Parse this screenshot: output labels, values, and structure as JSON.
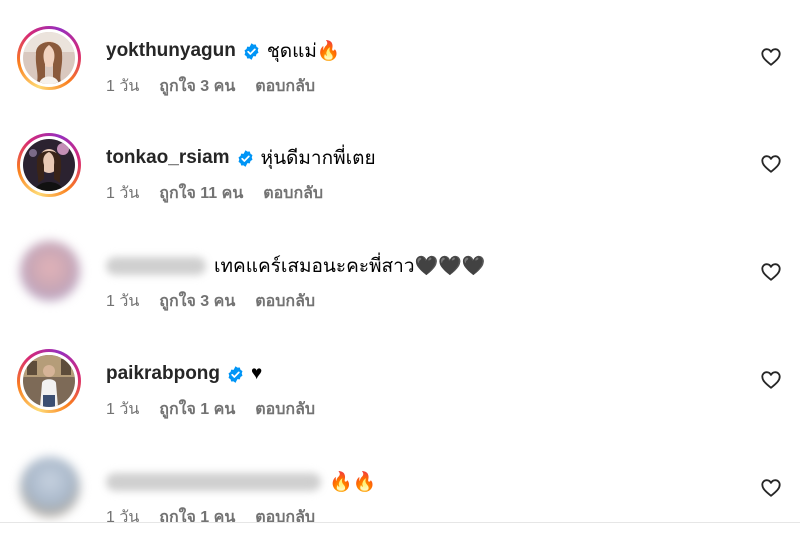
{
  "comments": [
    {
      "username": "yokthunyagun",
      "verified": true,
      "text": "ชุดแม่🔥",
      "time": "1 วัน",
      "likes": "ถูกใจ 3 คน",
      "reply": "ตอบกลับ",
      "avatar_blurred": false
    },
    {
      "username": "tonkao_rsiam",
      "verified": true,
      "text": "หุ่นดีมากพี่เตย",
      "time": "1 วัน",
      "likes": "ถูกใจ 11 คน",
      "reply": "ตอบกลับ",
      "avatar_blurred": false
    },
    {
      "username": "",
      "verified": false,
      "text": "เทคแคร์เสมอนะคะพี่สาว🖤🖤🖤",
      "time": "1 วัน",
      "likes": "ถูกใจ 3 คน",
      "reply": "ตอบกลับ",
      "avatar_blurred": true
    },
    {
      "username": "paikrabpong",
      "verified": true,
      "text": "♥",
      "time": "1 วัน",
      "likes": "ถูกใจ 1 คน",
      "reply": "ตอบกลับ",
      "avatar_blurred": false
    },
    {
      "username": "",
      "verified": false,
      "text": "🔥🔥",
      "time": "1 วัน",
      "likes": "ถูกใจ 1 คน",
      "reply": "ตอบกลับ",
      "avatar_blurred": true
    }
  ],
  "colors": {
    "verified_badge": "#0095f6",
    "secondary_text": "#737373",
    "primary_text": "#262626"
  },
  "icons": {
    "like": "heart-outline-icon",
    "verified": "verified-badge-icon"
  }
}
